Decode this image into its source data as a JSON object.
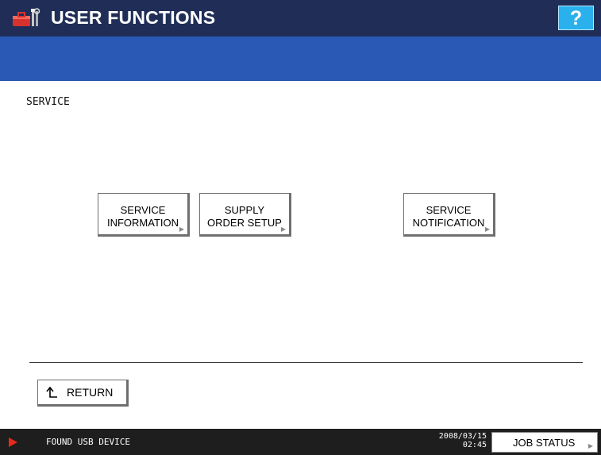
{
  "header": {
    "title": "USER FUNCTIONS",
    "title_icon": "tools-icon",
    "help_label": "?",
    "colors": {
      "title_bar": "#202e57",
      "sub_bar": "#2a59b5",
      "help_button": "#2bb0ee"
    }
  },
  "section": {
    "label": "SERVICE"
  },
  "buttons": [
    {
      "line1": "SERVICE",
      "line2": "INFORMATION"
    },
    {
      "line1": "SUPPLY",
      "line2": "ORDER SETUP"
    },
    {
      "line1": "SERVICE",
      "line2": "NOTIFICATION"
    }
  ],
  "return_button": {
    "label": "RETURN",
    "icon": "return-arrow-icon"
  },
  "status_bar": {
    "message": "FOUND USB DEVICE",
    "date": "2008/03/15",
    "time": "02:45",
    "job_status_label": "JOB STATUS",
    "alert_color": "#e8291c"
  }
}
